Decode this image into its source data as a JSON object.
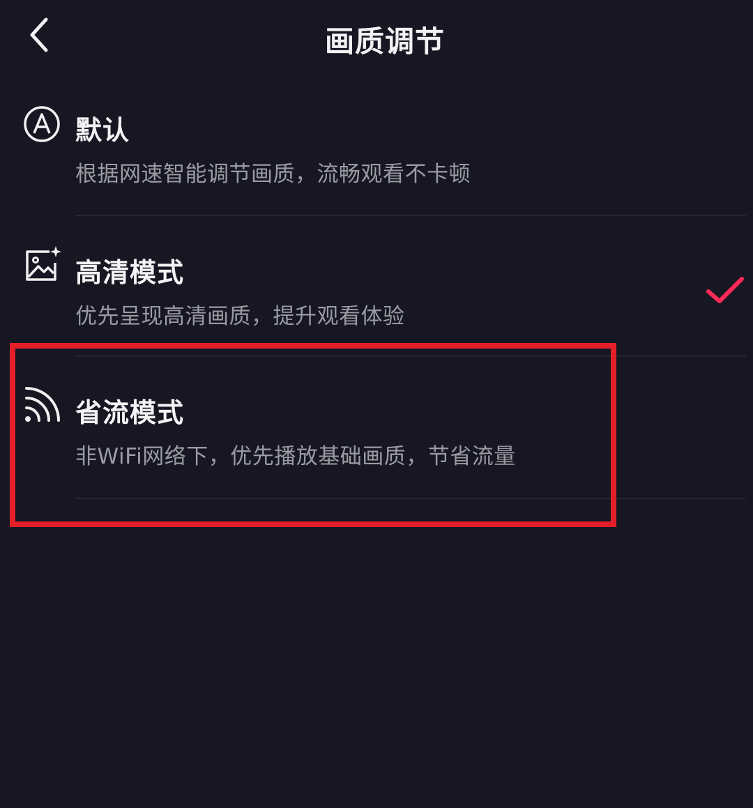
{
  "header": {
    "title": "画质调节",
    "back_icon": "chevron-left-icon"
  },
  "options": [
    {
      "id": "default",
      "icon": "auto-a-icon",
      "title": "默认",
      "description": "根据网速智能调节画质，流畅观看不卡顿",
      "selected": false
    },
    {
      "id": "hd",
      "icon": "hd-image-sparkle-icon",
      "title": "高清模式",
      "description": "优先呈现高清画质，提升观看体验",
      "selected": true
    },
    {
      "id": "data-saver",
      "icon": "signal-waves-icon",
      "title": "省流模式",
      "description": "非WiFi网络下，优先播放基础画质，节省流量",
      "selected": false,
      "highlighted": true
    }
  ],
  "colors": {
    "background": "#161722",
    "check_accent": "#ff2b55",
    "highlight_border": "#e3202a",
    "description_text": "#9a9ba4"
  }
}
